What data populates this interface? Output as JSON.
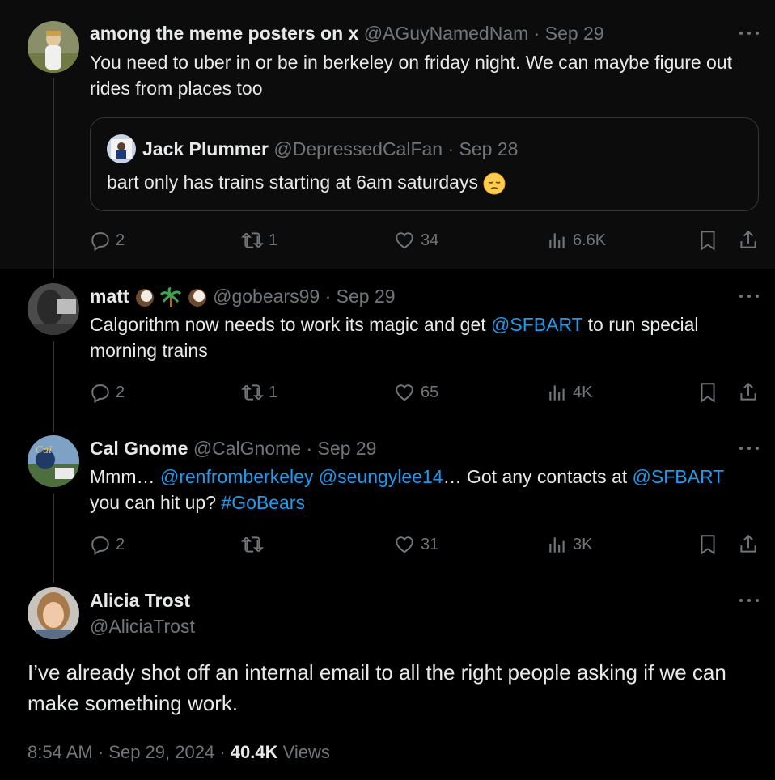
{
  "tweets": [
    {
      "name": "among the meme posters on x",
      "handle": "@AGuyNamedNam",
      "sep": "·",
      "date": "Sep 29",
      "text": "You need to uber in or be in berkeley on friday night. We can maybe figure out rides from places too",
      "quote": {
        "name": "Jack Plummer",
        "handle": "@DepressedCalFan",
        "sep": "·",
        "date": "Sep 28",
        "text": "bart only has trains starting at 6am saturdays",
        "emoji": "pensive-face-emoji"
      },
      "replies": "2",
      "reposts": "1",
      "likes": "34",
      "views": "6.6K"
    },
    {
      "name": "matt",
      "name_emojis": [
        "coconut-emoji",
        "palm-tree-emoji",
        "coconut-emoji"
      ],
      "handle": "@gobears99",
      "sep": "·",
      "date": "Sep 29",
      "text_1": "Calgorithm now needs to work its magic and get ",
      "mention_1": "@SFBART",
      "text_2": " to run special morning trains",
      "replies": "2",
      "reposts": "1",
      "likes": "65",
      "views": "4K"
    },
    {
      "name": "Cal Gnome",
      "handle": "@CalGnome",
      "sep": "·",
      "date": "Sep 29",
      "text_1": "Mmm… ",
      "mention_1": "@renfromberkeley",
      "space_1": " ",
      "mention_2": "@seungylee14",
      "text_2": "… Got any contacts at ",
      "mention_3": "@SFBART",
      "text_3": " you can hit up? ",
      "hashtag": "#GoBears",
      "replies": "2",
      "reposts": "",
      "likes": "31",
      "views": "3K"
    }
  ],
  "main": {
    "name": "Alicia Trost",
    "handle": "@AliciaTrost",
    "text": "I’ve already shot off an internal email to all the right people asking if we can make something work.",
    "time": "8:54 AM",
    "sep1": "·",
    "date": "Sep 29, 2024",
    "sep2": "·",
    "views_count": "40.4K",
    "views_label": "Views"
  },
  "colors": {
    "link": "#1d9bf0",
    "muted": "#71767b",
    "text": "#e7e9ea",
    "line": "#333639"
  }
}
